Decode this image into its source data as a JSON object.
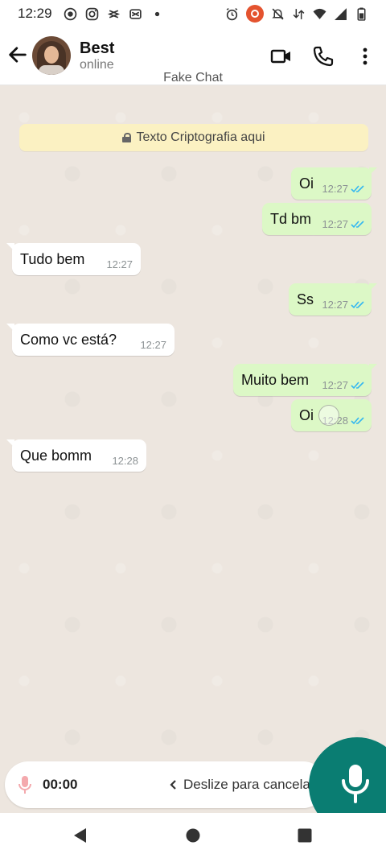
{
  "status_bar": {
    "time": "12:29",
    "left_icons": [
      "record-icon",
      "instagram-icon",
      "capcut-icon",
      "capcut-icon",
      "dot-icon"
    ],
    "right_icons": [
      "alarm-icon",
      "screen-record-icon",
      "mute-icon",
      "data-icon",
      "wifi-icon",
      "signal-icon",
      "battery-icon"
    ]
  },
  "header": {
    "contact_name": "Best",
    "contact_status": "online",
    "subtitle": "Fake Chat"
  },
  "banner": {
    "text": "Texto Criptografia aqui"
  },
  "messages": [
    {
      "direction": "out",
      "text": "Oi",
      "time": "12:27",
      "read": true
    },
    {
      "direction": "out",
      "text": "Td bm",
      "time": "12:27",
      "read": true
    },
    {
      "direction": "in",
      "text": "Tudo bem",
      "time": "12:27"
    },
    {
      "direction": "out",
      "text": "Ss",
      "time": "12:27",
      "read": true
    },
    {
      "direction": "in",
      "text": "Como vc está?",
      "time": "12:27"
    },
    {
      "direction": "out",
      "text": "Muito bem",
      "time": "12:27",
      "read": true
    },
    {
      "direction": "out",
      "text": "Oi",
      "time": "12:28",
      "read": true
    },
    {
      "direction": "in",
      "text": "Que bomm",
      "time": "12:28"
    }
  ],
  "recorder": {
    "timer": "00:00",
    "slide_hint": "Deslize para cancelar"
  },
  "colors": {
    "accent": "#0a7d72",
    "outgoing_bubble": "#dcf8c6",
    "incoming_bubble": "#ffffff",
    "chat_background": "#ede6df",
    "read_ticks": "#34b7f1",
    "banner": "#fbf1c2"
  }
}
